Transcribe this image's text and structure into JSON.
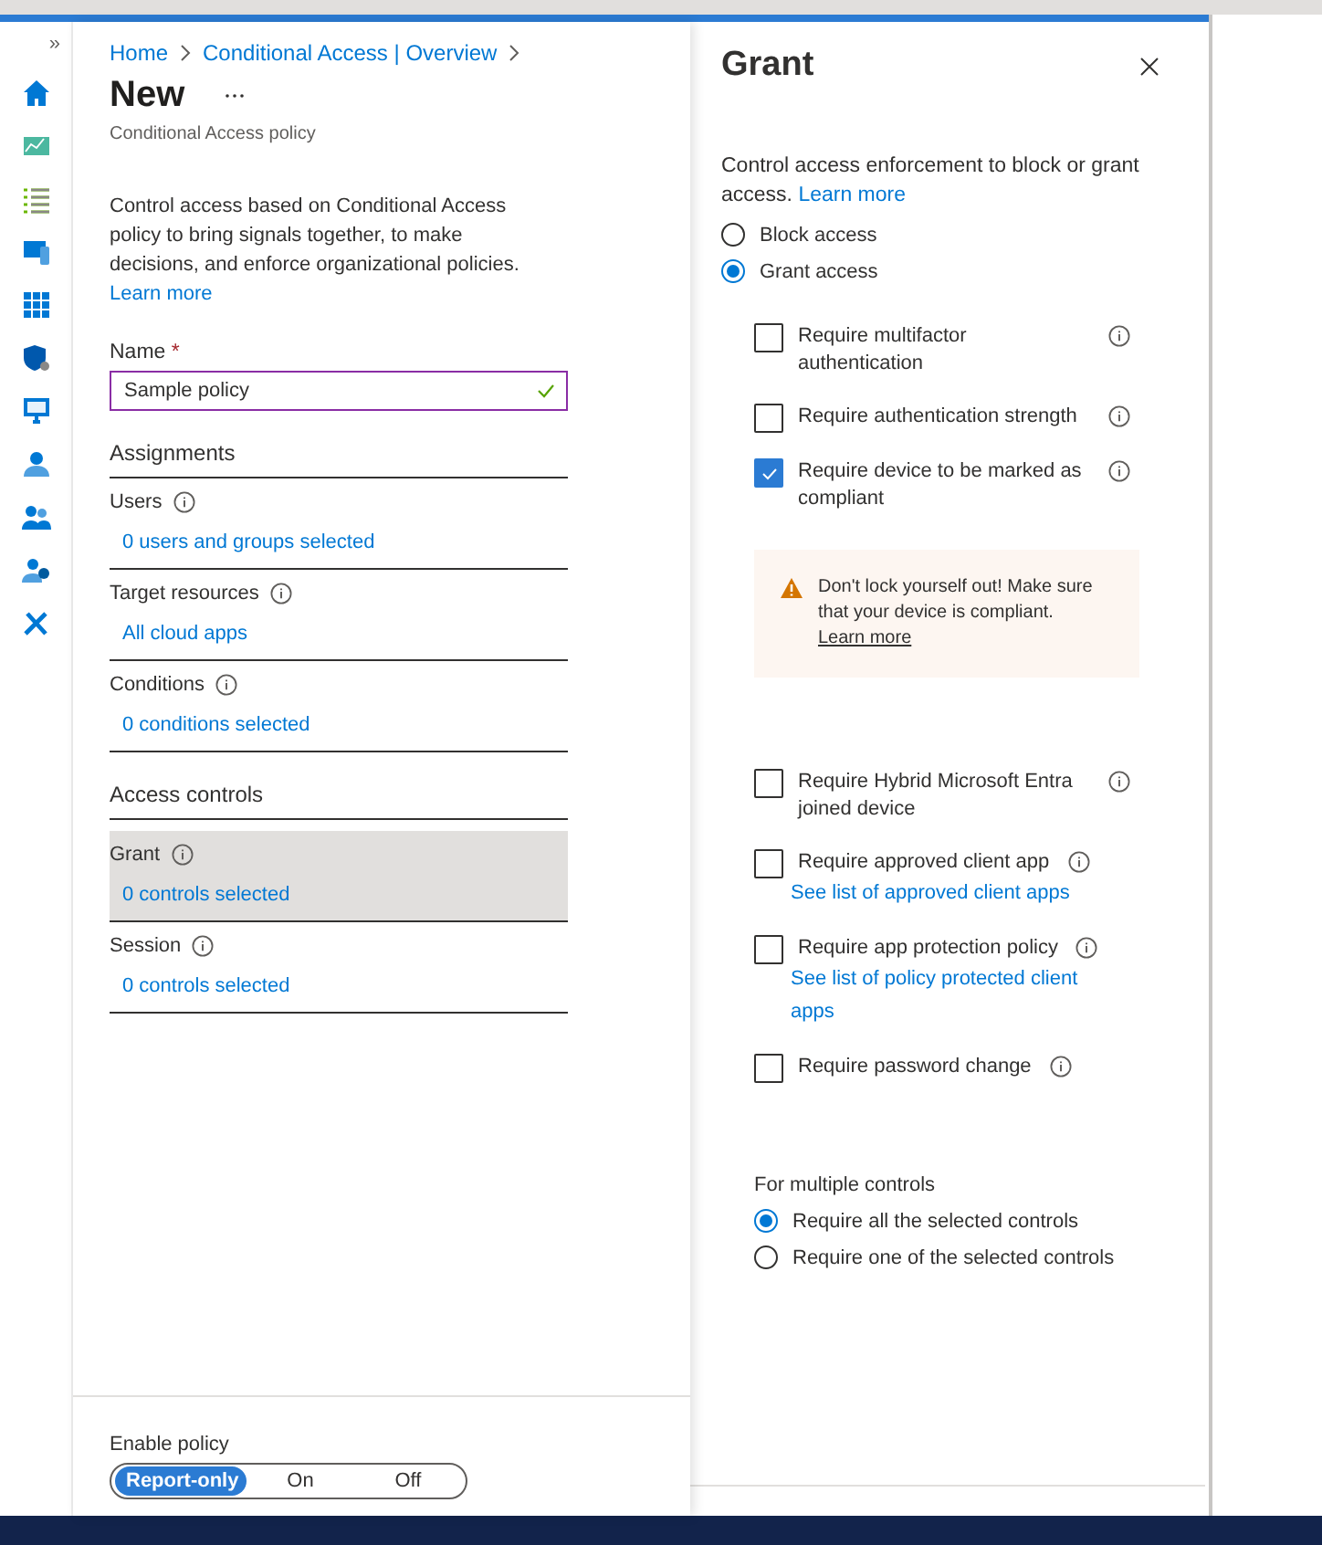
{
  "nav": {
    "expand_glyph": "»"
  },
  "breadcrumb": [
    "Home",
    "Conditional Access | Overview"
  ],
  "page": {
    "title": "New",
    "subtitle": "Conditional Access policy",
    "description": "Control access based on Conditional Access policy to bring signals together, to make decisions, and enforce organizational policies.",
    "learn_more": "Learn more"
  },
  "name_field": {
    "label": "Name",
    "required_mark": "*",
    "value": "Sample policy",
    "valid": true
  },
  "sections": [
    {
      "heading": "Assignments",
      "items": [
        {
          "label": "Users",
          "value": "0 users and groups selected",
          "selected": false
        },
        {
          "label": "Target resources",
          "value": "All cloud apps",
          "selected": false
        },
        {
          "label": "Conditions",
          "value": "0 conditions selected",
          "selected": false
        }
      ]
    },
    {
      "heading": "Access controls",
      "items": [
        {
          "label": "Grant",
          "value": "0 controls selected",
          "selected": true
        },
        {
          "label": "Session",
          "value": "0 controls selected",
          "selected": false
        }
      ]
    }
  ],
  "enable_policy": {
    "label": "Enable policy",
    "options": [
      {
        "label": "Report-only",
        "selected": true
      },
      {
        "label": "On",
        "selected": false
      },
      {
        "label": "Off",
        "selected": false
      }
    ]
  },
  "grant_panel": {
    "title": "Grant",
    "description": "Control access enforcement to block or grant access.",
    "learn_more": "Learn more",
    "access_options": [
      {
        "label": "Block access",
        "selected": false
      },
      {
        "label": "Grant access",
        "selected": true
      }
    ],
    "controls": [
      {
        "kind": "checkbox",
        "label": "Require multifactor authentication",
        "checked": false
      },
      {
        "kind": "checkbox",
        "label": "Require authentication strength",
        "checked": false
      },
      {
        "kind": "checkbox",
        "label": "Require device to be marked as compliant",
        "checked": true
      },
      {
        "kind": "warning",
        "text": "Don't lock yourself out! Make sure that your device is compliant.",
        "link": "Learn more"
      },
      {
        "kind": "checkbox",
        "label": "Require Hybrid Microsoft Entra joined device",
        "checked": false
      },
      {
        "kind": "checkbox",
        "label": "Require approved client app",
        "checked": false,
        "link": "See list of approved client apps"
      },
      {
        "kind": "checkbox",
        "label": "Require app protection policy",
        "checked": false,
        "link": "See list of policy protected client apps"
      },
      {
        "kind": "checkbox",
        "label": "Require password change",
        "checked": false
      }
    ],
    "multiple": {
      "label": "For multiple controls",
      "options": [
        {
          "label": "Require all the selected controls",
          "selected": true
        },
        {
          "label": "Require one of the selected controls",
          "selected": false
        }
      ]
    }
  }
}
